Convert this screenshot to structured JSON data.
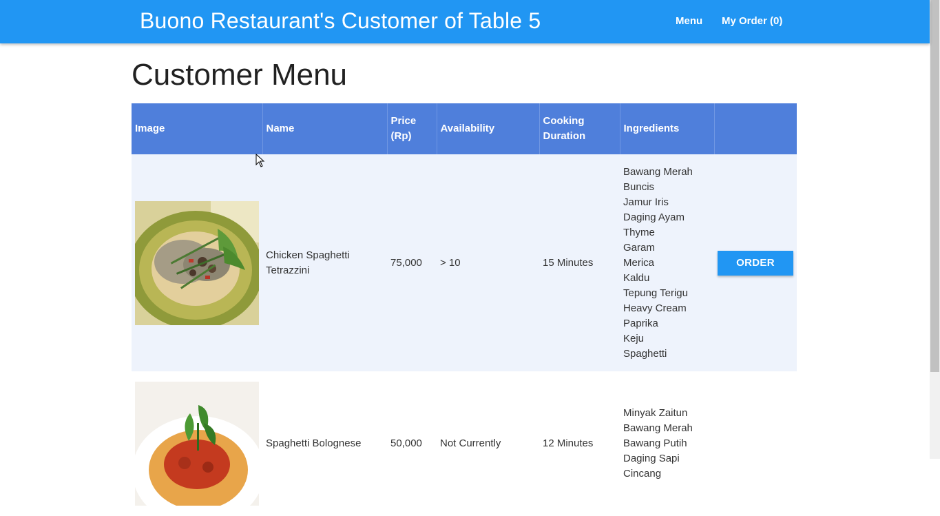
{
  "header": {
    "brand": "Buono Restaurant's Customer of Table 5",
    "nav": {
      "menu": "Menu",
      "my_order": "My Order (0)"
    }
  },
  "page": {
    "title": "Customer Menu"
  },
  "table": {
    "headers": {
      "image": "Image",
      "name": "Name",
      "price_line1": "Price",
      "price_line2": "(Rp)",
      "availability": "Availability",
      "cooking_line1": "Cooking",
      "cooking_line2": "Duration",
      "ingredients": "Ingredients",
      "action": ""
    },
    "rows": [
      {
        "name_line1": "Chicken Spaghetti",
        "name_line2": "Tetrazzini",
        "price": "75,000",
        "availability": "> 10",
        "cooking_duration": "15 Minutes",
        "ingredients": [
          "Bawang Merah",
          "Buncis",
          "Jamur Iris",
          "Daging Ayam",
          "Thyme",
          "Garam",
          "Merica",
          "Kaldu",
          "Tepung Terigu",
          "Heavy Cream",
          "Paprika",
          "Keju",
          "Spaghetti"
        ],
        "button": "ORDER"
      },
      {
        "name": "Spaghetti Bolognese",
        "price": "50,000",
        "availability": "Not Currently",
        "cooking_duration": "12 Minutes",
        "ingredients": [
          "Minyak Zaitun",
          "Bawang Merah",
          "Bawang Putih",
          "Daging Sapi",
          "Cincang"
        ]
      }
    ]
  }
}
